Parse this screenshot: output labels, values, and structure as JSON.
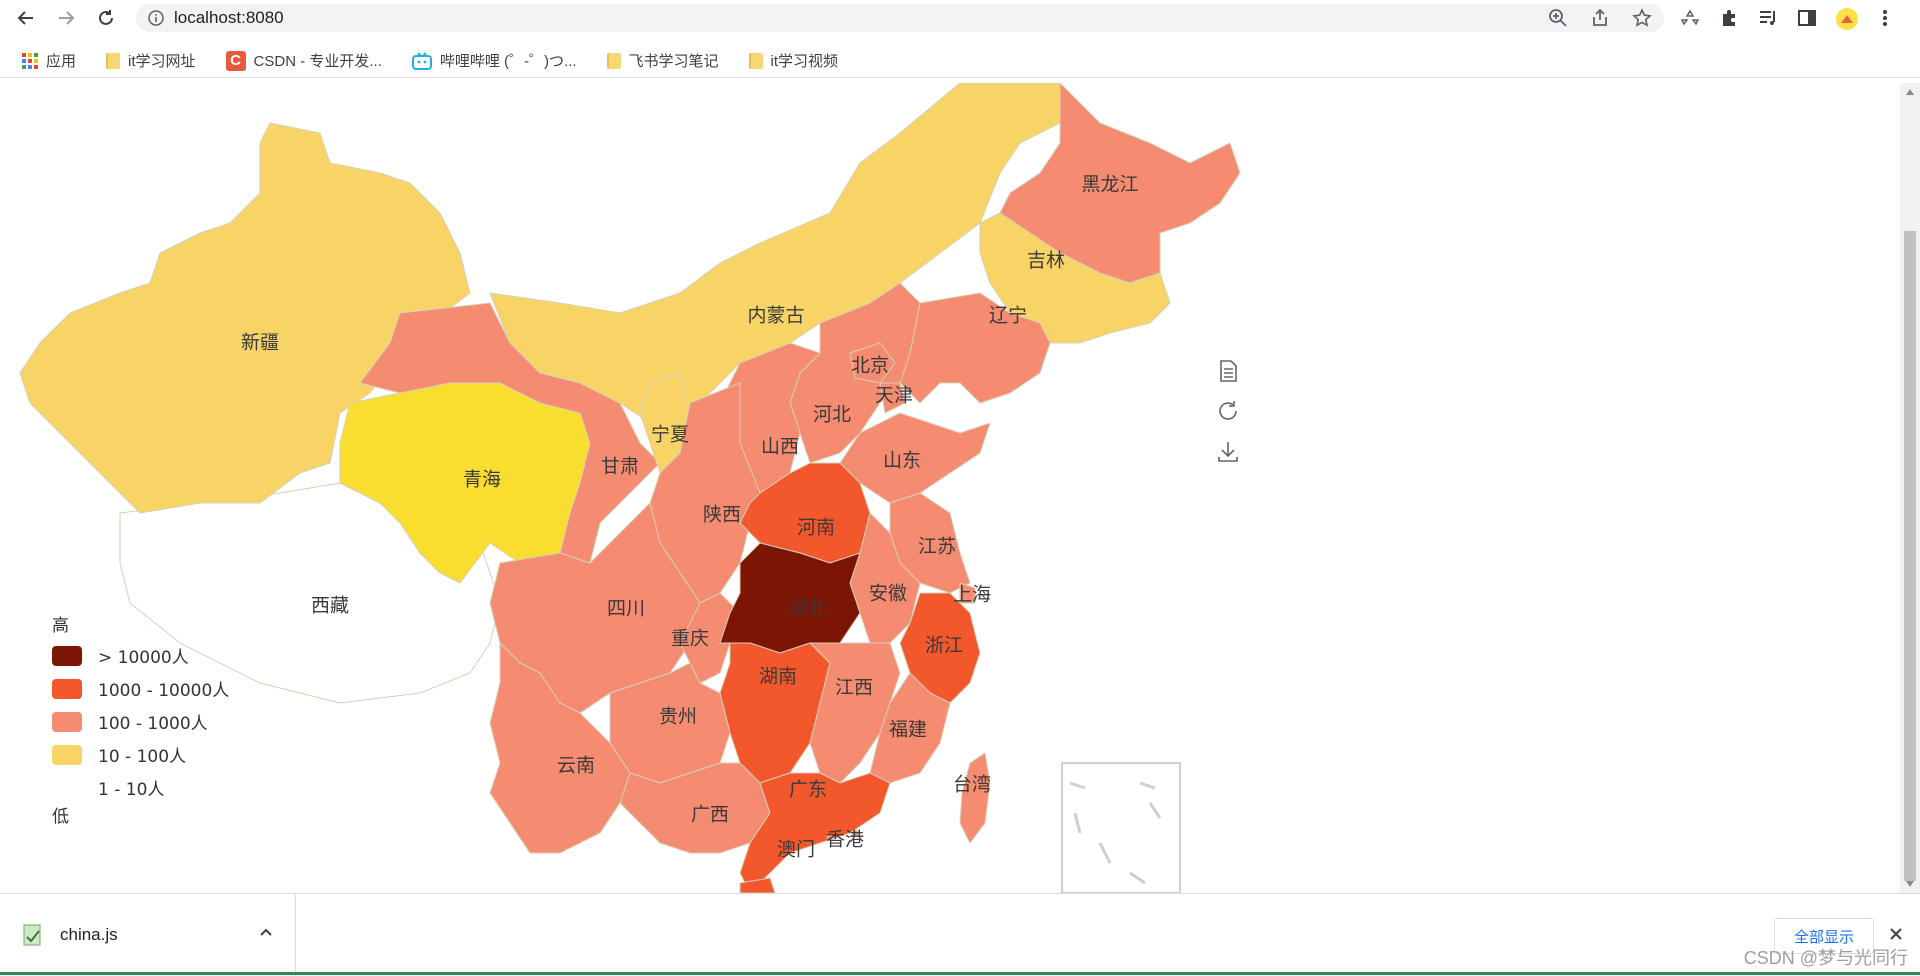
{
  "browser": {
    "url": "localhost:8080"
  },
  "bookmarks": [
    {
      "label": "应用",
      "icon": "apps-grid-icon"
    },
    {
      "label": "it学习网址",
      "icon": "folder-icon"
    },
    {
      "label": "CSDN - 专业开发...",
      "icon": "csdn-logo-icon"
    },
    {
      "label": "哔哩哔哩 (゜-゜)つ...",
      "icon": "bilibili-icon"
    },
    {
      "label": "飞书学习笔记",
      "icon": "folder-icon"
    },
    {
      "label": "it学习视频",
      "icon": "folder-icon"
    }
  ],
  "legend": {
    "high": "高",
    "low": "低",
    "items": [
      {
        "label": "> 10000人",
        "color": "#7d1505"
      },
      {
        "label": "1000 - 10000人",
        "color": "#f3582c"
      },
      {
        "label": "100 - 1000人",
        "color": "#f58b70"
      },
      {
        "label": "10 - 100人",
        "color": "#f8d466"
      },
      {
        "label": "1 - 10人",
        "color": "#ffffff"
      }
    ]
  },
  "provinces": {
    "xinjiang": "新疆",
    "xizang": "西藏",
    "qinghai": "青海",
    "gansu": "甘肃",
    "neimenggu": "内蒙古",
    "heilongjiang": "黑龙江",
    "jilin": "吉林",
    "liaoning": "辽宁",
    "beijing": "北京",
    "tianjin": "天津",
    "hebei": "河北",
    "shanxi": "山西",
    "shandong": "山东",
    "ningxia": "宁夏",
    "shaanxi": "陕西",
    "henan": "河南",
    "jiangsu": "江苏",
    "anhui": "安徽",
    "shanghai": "上海",
    "hubei": "湖北",
    "sichuan": "四川",
    "chongqing": "重庆",
    "zhejiang": "浙江",
    "hunan": "湖南",
    "jiangxi": "江西",
    "guizhou": "贵州",
    "yunnan": "云南",
    "fujian": "福建",
    "guangxi": "广西",
    "guangdong": "广东",
    "taiwan": "台湾",
    "aomen": "澳门",
    "xianggang": "香港"
  },
  "download": {
    "filename": "china.js",
    "show_all": "全部显示"
  },
  "watermark": "CSDN @梦与光同行",
  "colors": {
    "highest": "#7d1505",
    "high": "#f3582c",
    "mid": "#f58b70",
    "low": "#f8d466",
    "qinghai": "#f9dd2f",
    "none": "#ffffff"
  }
}
